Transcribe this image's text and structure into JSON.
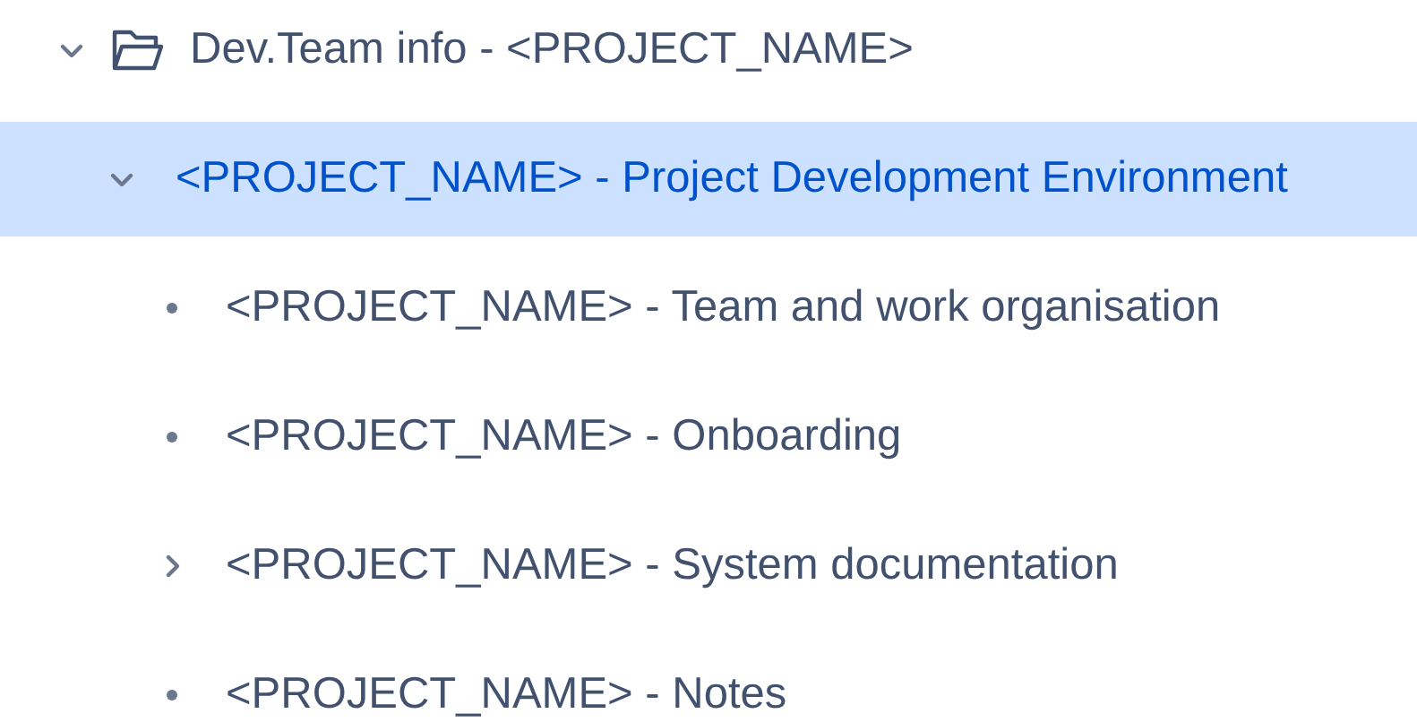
{
  "tree": [
    {
      "label": "Dev.Team info - <PROJECT_NAME>",
      "kind": "folder",
      "expanded": true,
      "selected": false,
      "children": [
        {
          "label": "<PROJECT_NAME> - Project Development Environment",
          "kind": "branch",
          "expanded": true,
          "selected": true,
          "children": [
            {
              "label": "<PROJECT_NAME> - Team and work organisation",
              "kind": "page",
              "selected": false
            },
            {
              "label": "<PROJECT_NAME> - Onboarding",
              "kind": "page",
              "selected": false
            },
            {
              "label": "<PROJECT_NAME> - System documentation",
              "kind": "branch",
              "expanded": false,
              "selected": false
            },
            {
              "label": "<PROJECT_NAME> - Notes",
              "kind": "page",
              "selected": false
            }
          ]
        }
      ]
    }
  ]
}
